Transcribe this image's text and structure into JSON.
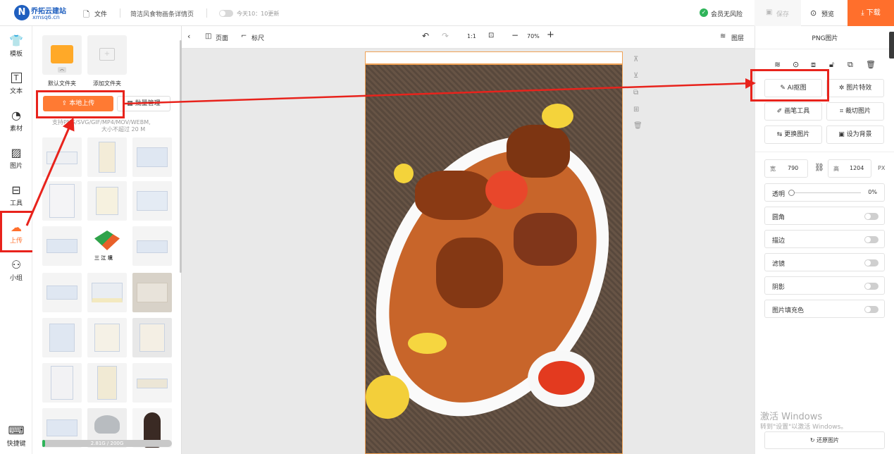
{
  "brand": {
    "name": "乔拓云建站",
    "domain": "xmsq6.cn"
  },
  "topbar": {
    "file": "文件",
    "doc_title": "简洁风食物画条详情页",
    "update_note": "今天10：10更新",
    "member": "会员无风险",
    "save": "保存",
    "preview": "预览",
    "download": "下载"
  },
  "leftnav": [
    "模板",
    "文本",
    "素材",
    "图片",
    "工具",
    "上传",
    "小组",
    "快捷键"
  ],
  "panel": {
    "default_folder": "默认文件夹",
    "add_folder": "添加文件夹",
    "upload": "本地上传",
    "batch": "批量管理",
    "hint1": "支持PNG/SVG/GIF/MP4/MOV/WEBM,",
    "hint2": "大小不超过 20 M",
    "storage": "2.81G / 200G"
  },
  "workbar": {
    "page": "页面",
    "ruler": "标尺",
    "ratio": "1:1",
    "zoom": "70%",
    "layers": "图层"
  },
  "rightpanel": {
    "title": "PNG图片",
    "ai_matting": "AI抠图",
    "effects": "图片特效",
    "brush": "画笔工具",
    "crop": "裁切图片",
    "replace": "更换图片",
    "set_bg": "设为背景",
    "width_label": "宽",
    "width": "790",
    "height_label": "高",
    "height": "1204",
    "unit": "PX",
    "opacity": "透明",
    "opacity_value": "0%",
    "radius": "圆角",
    "stroke": "描边",
    "filter": "滤镜",
    "shadow": "阴影",
    "fill": "图片填充色",
    "restore": "还原图片"
  },
  "watermark": {
    "line1": "激活 Windows",
    "line2": "转到\"设置\"以激活 Windows。"
  }
}
